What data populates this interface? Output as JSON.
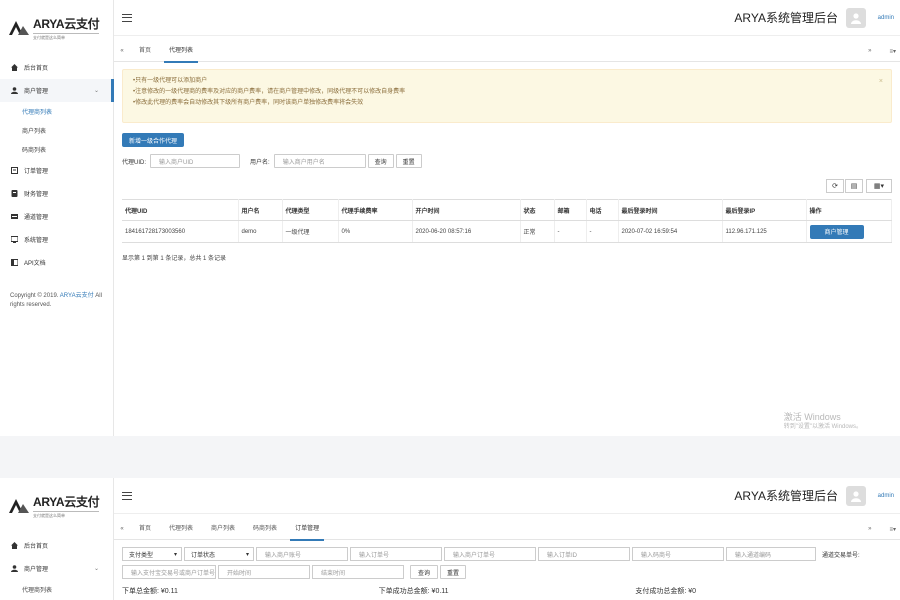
{
  "brand": {
    "logo_text": "ARYA云支付",
    "logo_sub": "支付就是这么简单",
    "system_title": "ARYA系统管理后台",
    "username": "admin"
  },
  "sidebar": {
    "items": [
      {
        "label": "后台首页",
        "icon": "home-icon"
      },
      {
        "label": "商户管理",
        "icon": "user-icon",
        "expanded": true
      },
      {
        "label": "订单管理",
        "icon": "order-icon"
      },
      {
        "label": "财务管理",
        "icon": "finance-icon"
      },
      {
        "label": "通道管理",
        "icon": "channel-icon"
      },
      {
        "label": "系统管理",
        "icon": "system-icon"
      },
      {
        "label": "API文档",
        "icon": "doc-icon"
      }
    ],
    "sub_items": [
      "代理商列表",
      "商户列表",
      "码商列表"
    ],
    "copyright_prefix": "Copyright © 2019. ",
    "copyright_brand": "ARYA云支付",
    "copyright_suffix": " All rights reserved."
  },
  "panel1": {
    "tabs": [
      "首页",
      "代理列表"
    ],
    "notice": [
      "•只有一级代理可以添加商户",
      "•注意修改的一级代理商的费率及对应的商户费率，请在商户管理中修改，同级代理不可以修改自身费率",
      "•修改此代理的费率会自动修改其下级所有商户费率，同时该商户单独修改费率将会失效"
    ],
    "add_button": "新增一级合作代理",
    "search": {
      "uid_label": "代理UID:",
      "uid_placeholder": "输入商户UID",
      "name_label": "用户名:",
      "name_placeholder": "输入商户用户名",
      "search_btn": "查询",
      "reset_btn": "重置"
    },
    "table": {
      "headers": [
        "代理UID",
        "用户名",
        "代理类型",
        "代理手续费率",
        "开户时间",
        "状态",
        "邮箱",
        "电话",
        "最后登录时间",
        "最后登录IP",
        "操作"
      ],
      "rows": [
        [
          "184161728173003560",
          "demo",
          "一级代理",
          "0%",
          "2020-06-20 08:57:16",
          "正常",
          "-",
          "-",
          "2020-07-02 16:59:54",
          "112.96.171.125",
          "商户管理"
        ]
      ]
    },
    "pager": "显示第 1 到第 1 条记录，总共 1 条记录",
    "watermark_title": "激活 Windows",
    "watermark_sub": "转到\"设置\"以激活 Windows。"
  },
  "panel2": {
    "tabs": [
      "首页",
      "代理列表",
      "商户列表",
      "码商列表",
      "订单管理"
    ],
    "filters_row1": [
      "支付类型",
      "订单状态",
      "输入商户账号",
      "输入订单号",
      "输入商户订单号",
      "输入订单ID",
      "输入码商号",
      "输入通道编码"
    ],
    "filter_label": "通道交易单号:",
    "filters_row2": [
      "输入支付宝交易号或商户订单号",
      "开始时间",
      "结束时间"
    ],
    "search_btn": "查询",
    "reset_btn": "重置",
    "stats": [
      "下单总金额: ¥0.11",
      "下单成功总金额: ¥0.11",
      "支付成功总金额: ¥0"
    ]
  }
}
